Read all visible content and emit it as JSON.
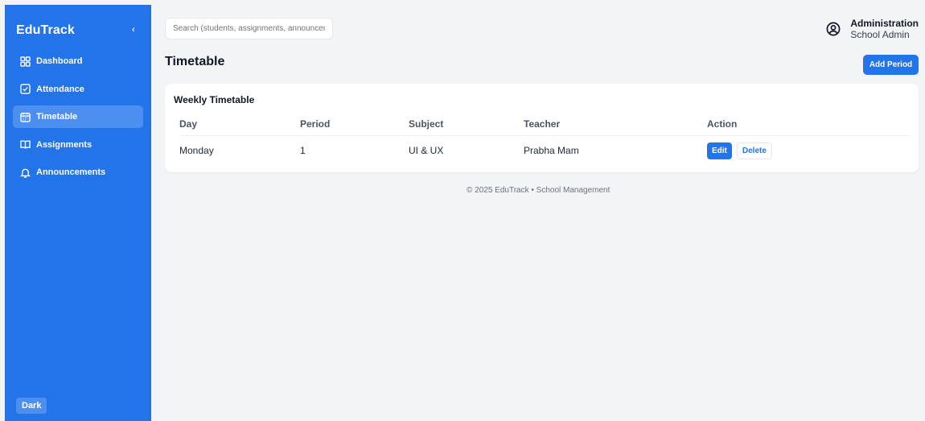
{
  "app": {
    "brand": "EduTrack",
    "collapse_glyph": "‹"
  },
  "sidebar": {
    "items": [
      {
        "label": "Dashboard",
        "icon": "grid-icon"
      },
      {
        "label": "Attendance",
        "icon": "check-square-icon"
      },
      {
        "label": "Timetable",
        "icon": "calendar-icon",
        "active": true
      },
      {
        "label": "Assignments",
        "icon": "book-icon"
      },
      {
        "label": "Announcements",
        "icon": "bell-icon"
      }
    ],
    "dark_label": "Dark"
  },
  "header": {
    "search_placeholder": "Search (students, assignments, announcements)",
    "user_role": "Administration",
    "user_name": "School Admin",
    "user_icon": "user-circle-icon"
  },
  "page": {
    "title": "Timetable",
    "add_label": "Add Period"
  },
  "timetable": {
    "card_title": "Weekly Timetable",
    "columns": [
      "Day",
      "Period",
      "Subject",
      "Teacher",
      "Action"
    ],
    "rows": [
      {
        "day": "Monday",
        "period": "1",
        "subject": "UI & UX",
        "teacher": "Prabha Mam"
      }
    ],
    "edit_label": "Edit",
    "delete_label": "Delete"
  },
  "footer": {
    "text": "© 2025 EduTrack • School Management"
  },
  "colors": {
    "primary": "#2374e8",
    "active_nav": "#4d8ff0",
    "background": "#f3f4f6"
  }
}
